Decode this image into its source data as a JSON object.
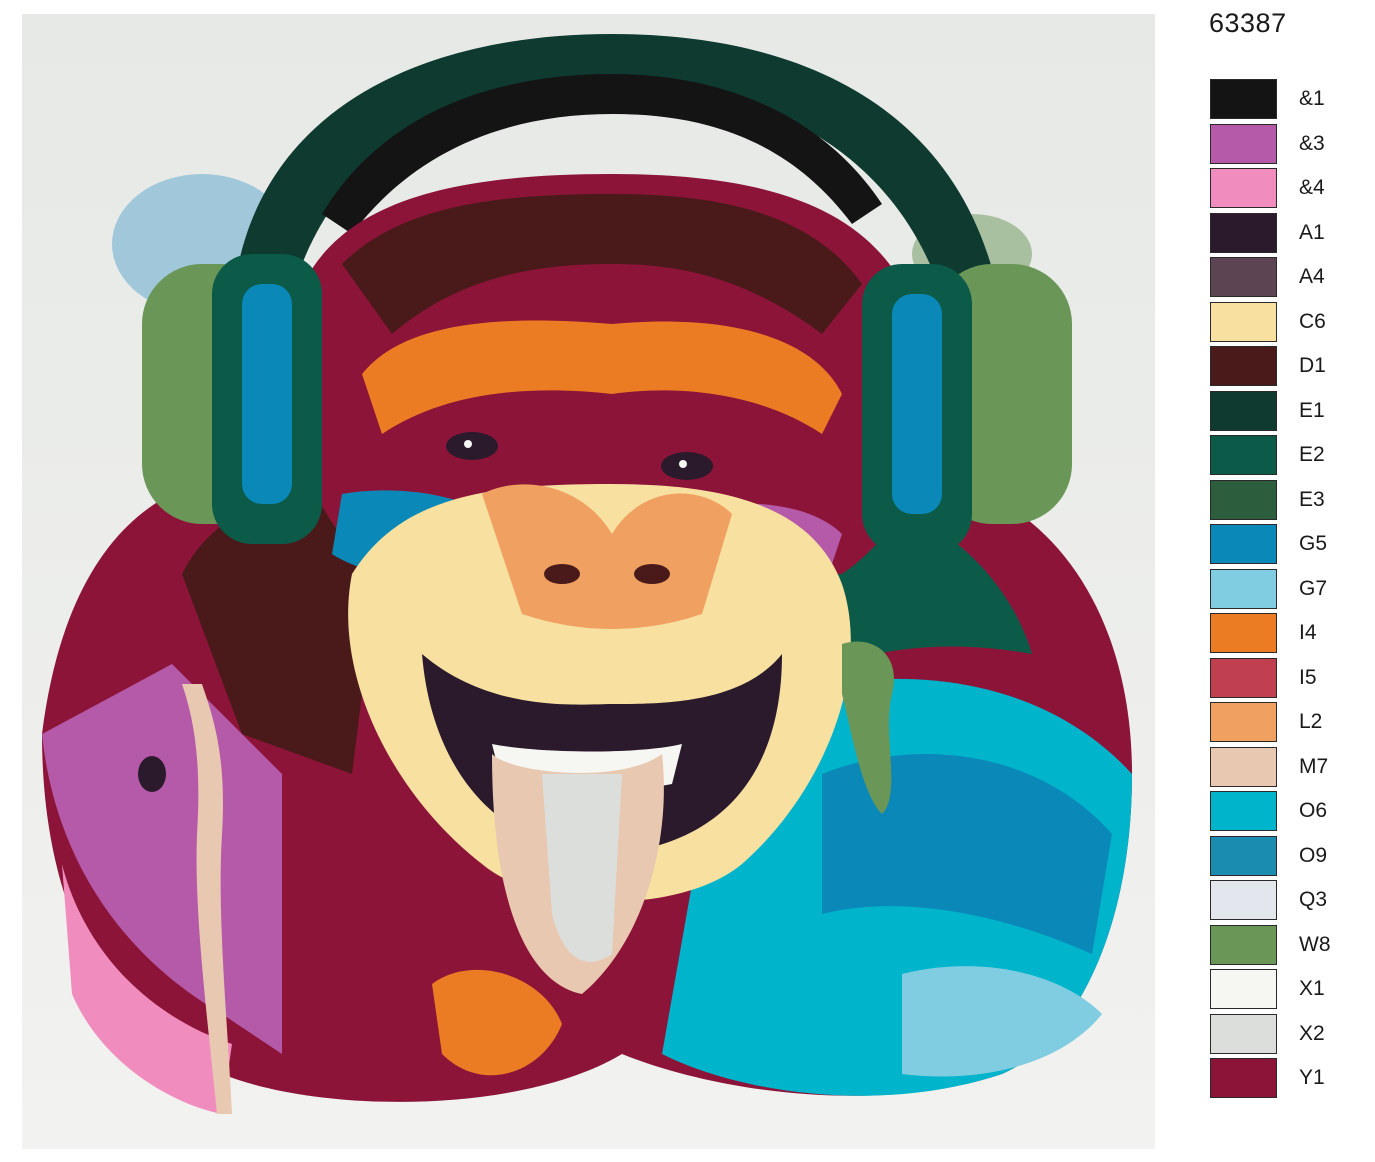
{
  "product_code": "63387",
  "artwork": {
    "subject_icon": "chimpanzee-with-headphones-painting"
  },
  "palette": [
    {
      "code": "&1",
      "color": "#141414"
    },
    {
      "code": "&3",
      "color": "#b45aa8"
    },
    {
      "code": "&4",
      "color": "#f08cbe"
    },
    {
      "code": "A1",
      "color": "#2a1a2c"
    },
    {
      "code": "A4",
      "color": "#5c4452"
    },
    {
      "code": "C6",
      "color": "#f8e0a0"
    },
    {
      "code": "D1",
      "color": "#4a1a1a"
    },
    {
      "code": "E1",
      "color": "#0e3a30"
    },
    {
      "code": "E2",
      "color": "#0c5a48"
    },
    {
      "code": "E3",
      "color": "#2c5e3e"
    },
    {
      "code": "G5",
      "color": "#0a88b8"
    },
    {
      "code": "G7",
      "color": "#80cce0"
    },
    {
      "code": "I4",
      "color": "#ec7c24"
    },
    {
      "code": "I5",
      "color": "#c04050"
    },
    {
      "code": "L2",
      "color": "#f0a060"
    },
    {
      "code": "M7",
      "color": "#e8c8b0"
    },
    {
      "code": "O6",
      "color": "#00b4cc"
    },
    {
      "code": "O9",
      "color": "#1a8cb0"
    },
    {
      "code": "Q3",
      "color": "#e4e6ee"
    },
    {
      "code": "W8",
      "color": "#6a9658"
    },
    {
      "code": "X1",
      "color": "#f6f6f2"
    },
    {
      "code": "X2",
      "color": "#dcdedc"
    },
    {
      "code": "Y1",
      "color": "#8c1438"
    }
  ]
}
